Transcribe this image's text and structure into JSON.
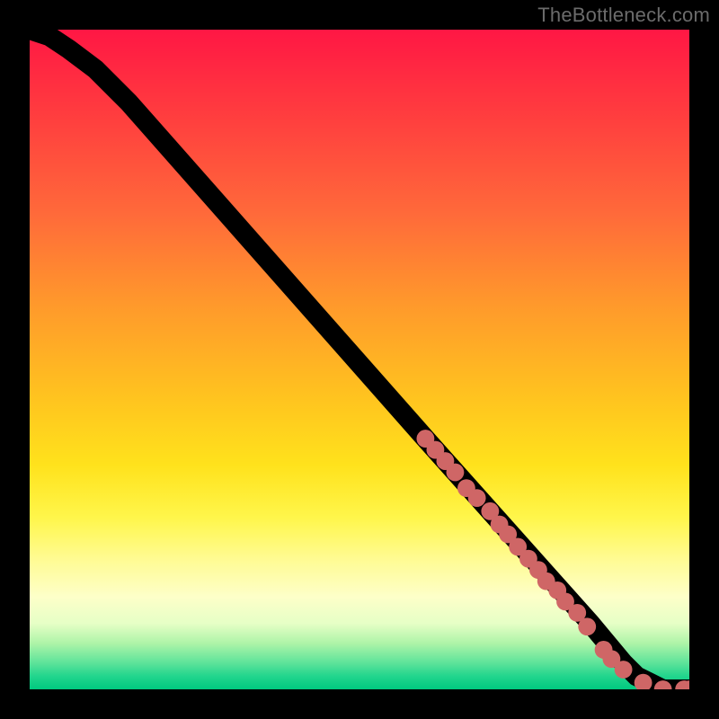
{
  "watermark": "TheBottleneck.com",
  "chart_data": {
    "type": "line",
    "title": "",
    "xlabel": "",
    "ylabel": "",
    "xlim": [
      0,
      100
    ],
    "ylim": [
      0,
      100
    ],
    "grid": false,
    "legend": false,
    "series": [
      {
        "name": "curve",
        "x": [
          0,
          3,
          6,
          10,
          15,
          60,
          85,
          90,
          92,
          94,
          96,
          100
        ],
        "values": [
          100,
          99,
          97,
          94,
          89,
          38,
          10,
          4,
          2,
          1,
          0,
          0
        ]
      }
    ],
    "markers": {
      "name": "highlighted-points",
      "color": "#cf6666",
      "points": [
        {
          "x": 60.0,
          "y": 38.0
        },
        {
          "x": 61.5,
          "y": 36.3
        },
        {
          "x": 63.0,
          "y": 34.6
        },
        {
          "x": 64.5,
          "y": 32.9
        },
        {
          "x": 66.2,
          "y": 30.5
        },
        {
          "x": 67.8,
          "y": 29.0
        },
        {
          "x": 69.8,
          "y": 27.0
        },
        {
          "x": 71.2,
          "y": 25.0
        },
        {
          "x": 72.5,
          "y": 23.5
        },
        {
          "x": 74.0,
          "y": 21.6
        },
        {
          "x": 75.6,
          "y": 19.8
        },
        {
          "x": 77.1,
          "y": 18.1
        },
        {
          "x": 78.3,
          "y": 16.4
        },
        {
          "x": 80.0,
          "y": 15.0
        },
        {
          "x": 81.2,
          "y": 13.3
        },
        {
          "x": 83.0,
          "y": 11.6
        },
        {
          "x": 84.5,
          "y": 9.5
        },
        {
          "x": 87.0,
          "y": 6.0
        },
        {
          "x": 88.2,
          "y": 4.6
        },
        {
          "x": 90.0,
          "y": 3.0
        },
        {
          "x": 93.0,
          "y": 1.0
        },
        {
          "x": 96.0,
          "y": 0.0
        },
        {
          "x": 99.2,
          "y": 0.0
        },
        {
          "x": 100.0,
          "y": 0.0
        }
      ]
    },
    "background_gradient": {
      "direction": "top-to-bottom",
      "stops": [
        {
          "pos": 0.0,
          "color": "#ff1744"
        },
        {
          "pos": 0.28,
          "color": "#ff6a3a"
        },
        {
          "pos": 0.56,
          "color": "#ffc41f"
        },
        {
          "pos": 0.8,
          "color": "#fffb90"
        },
        {
          "pos": 0.93,
          "color": "#aef4a8"
        },
        {
          "pos": 1.0,
          "color": "#00c97f"
        }
      ]
    }
  }
}
